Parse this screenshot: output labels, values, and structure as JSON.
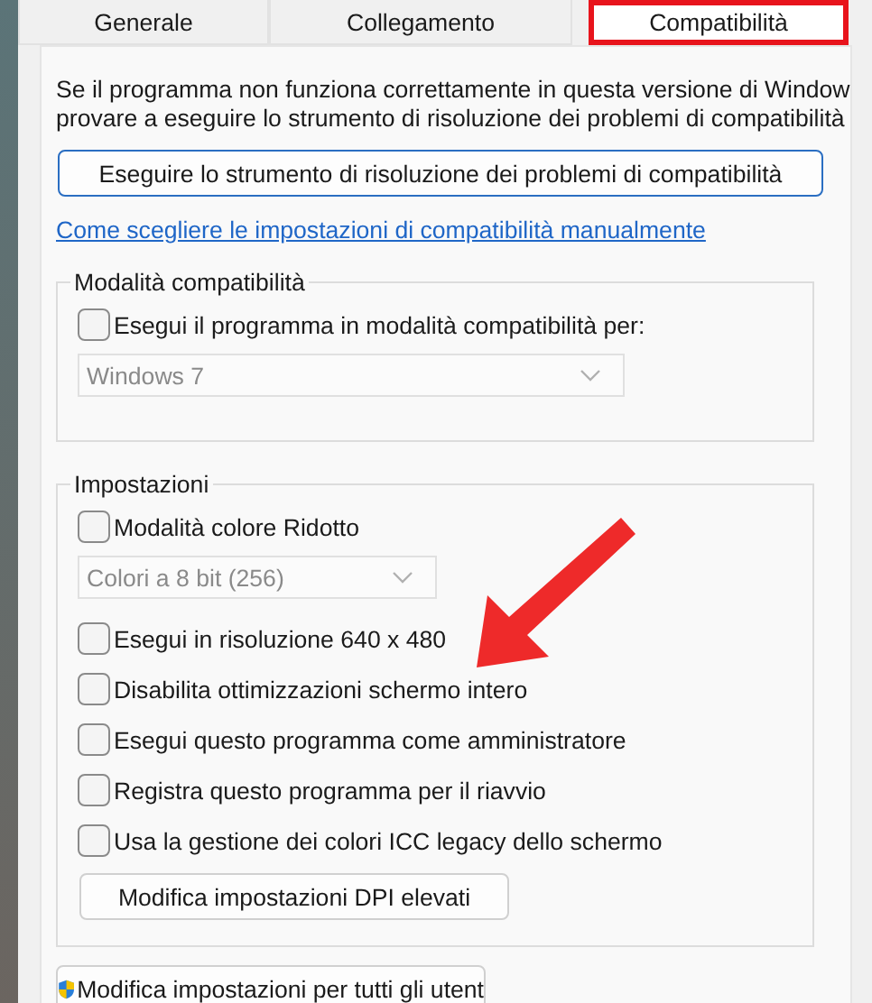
{
  "tabs": [
    {
      "label": "Generale",
      "selected": false,
      "highlighted": false
    },
    {
      "label": "Collegamento",
      "selected": false,
      "highlighted": false
    },
    {
      "label": "Compatibilità",
      "selected": true,
      "highlighted": true
    }
  ],
  "intro_lines": [
    "Se il programma non funziona correttamente in questa versione di Window",
    "provare a eseguire lo strumento di risoluzione dei problemi di compatibilità"
  ],
  "troubleshooter_button": "Eseguire lo strumento di risoluzione dei problemi di compatibilità",
  "manual_link": "Come scegliere le impostazioni di compatibilità manualmente",
  "compat_group": {
    "title": "Modalità compatibilità",
    "items": [
      {
        "kind": "checkbox",
        "label": "Esegui il programma in modalità compatibilità per:",
        "checked": false
      },
      {
        "kind": "dropdown",
        "value": "Windows 7",
        "disabled": true
      }
    ]
  },
  "settings_group": {
    "title": "Impostazioni",
    "items": [
      {
        "kind": "checkbox",
        "label": "Modalità colore Ridotto",
        "checked": false
      },
      {
        "kind": "dropdown",
        "value": "Colori a 8 bit (256)",
        "disabled": true
      },
      {
        "kind": "checkbox",
        "label": "Esegui in risoluzione 640 x 480",
        "checked": false
      },
      {
        "kind": "checkbox",
        "label": "Disabilita ottimizzazioni schermo intero",
        "checked": false
      },
      {
        "kind": "checkbox",
        "label": "Esegui questo programma come amministratore",
        "checked": false
      },
      {
        "kind": "checkbox",
        "label": "Registra questo programma per il riavvio",
        "checked": false
      },
      {
        "kind": "checkbox",
        "label": "Usa la gestione dei colori ICC legacy dello schermo",
        "checked": false
      }
    ],
    "dpi_button": "Modifica impostazioni DPI elevati"
  },
  "all_users_button": "Modifica impostazioni per tutti gli utent"
}
